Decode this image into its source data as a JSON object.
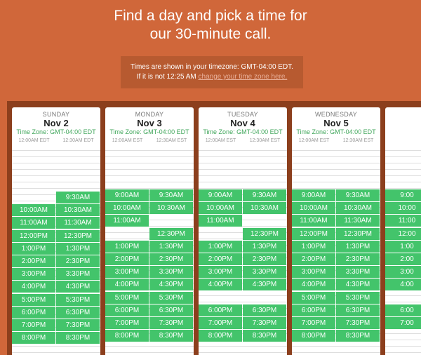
{
  "header": {
    "line1": "Find a day and pick a time for",
    "line2": "our 30-minute call."
  },
  "timezone_notice": {
    "text": "Times are shown in your timezone: GMT-04:00 EDT. If it is not 12:25 AM",
    "link": "change your time zone here."
  },
  "days": [
    {
      "weekday": "SUNDAY",
      "date": "Nov 2",
      "tz": "Time Zone: GMT-04:00 EDT",
      "col_left": "12:00AM EDT",
      "col_right": "12:30AM EDT",
      "slots": [
        {
          "time": "9:30AM",
          "col": "r",
          "row": 0
        },
        {
          "time": "10:00AM",
          "col": "l",
          "row": 1
        },
        {
          "time": "10:30AM",
          "col": "r",
          "row": 1
        },
        {
          "time": "11:00AM",
          "col": "l",
          "row": 2
        },
        {
          "time": "11:30AM",
          "col": "r",
          "row": 2
        },
        {
          "time": "12:00PM",
          "col": "l",
          "row": 3
        },
        {
          "time": "12:30PM",
          "col": "r",
          "row": 3
        },
        {
          "time": "1:00PM",
          "col": "l",
          "row": 4
        },
        {
          "time": "1:30PM",
          "col": "r",
          "row": 4
        },
        {
          "time": "2:00PM",
          "col": "l",
          "row": 5
        },
        {
          "time": "2:30PM",
          "col": "r",
          "row": 5
        },
        {
          "time": "3:00PM",
          "col": "l",
          "row": 6
        },
        {
          "time": "3:30PM",
          "col": "r",
          "row": 6
        },
        {
          "time": "4:00PM",
          "col": "l",
          "row": 7
        },
        {
          "time": "4:30PM",
          "col": "r",
          "row": 7
        },
        {
          "time": "5:00PM",
          "col": "l",
          "row": 8
        },
        {
          "time": "5:30PM",
          "col": "r",
          "row": 8
        },
        {
          "time": "6:00PM",
          "col": "l",
          "row": 9
        },
        {
          "time": "6:30PM",
          "col": "r",
          "row": 9
        },
        {
          "time": "7:00PM",
          "col": "l",
          "row": 10
        },
        {
          "time": "7:30PM",
          "col": "r",
          "row": 10
        },
        {
          "time": "8:00PM",
          "col": "l",
          "row": 11
        },
        {
          "time": "8:30PM",
          "col": "r",
          "row": 11
        }
      ]
    },
    {
      "weekday": "MONDAY",
      "date": "Nov 3",
      "tz": "Time Zone: GMT-04:00 EDT",
      "col_left": "12:00AM EST",
      "col_right": "12:30AM EST",
      "slots": [
        {
          "time": "9:00AM",
          "col": "l",
          "row": 0
        },
        {
          "time": "9:30AM",
          "col": "r",
          "row": 0
        },
        {
          "time": "10:00AM",
          "col": "l",
          "row": 1
        },
        {
          "time": "10:30AM",
          "col": "r",
          "row": 1
        },
        {
          "time": "11:00AM",
          "col": "l",
          "row": 2
        },
        {
          "time": "12:30PM",
          "col": "r",
          "row": 3
        },
        {
          "time": "1:00PM",
          "col": "l",
          "row": 4
        },
        {
          "time": "1:30PM",
          "col": "r",
          "row": 4
        },
        {
          "time": "2:00PM",
          "col": "l",
          "row": 5
        },
        {
          "time": "2:30PM",
          "col": "r",
          "row": 5
        },
        {
          "time": "3:00PM",
          "col": "l",
          "row": 6
        },
        {
          "time": "3:30PM",
          "col": "r",
          "row": 6
        },
        {
          "time": "4:00PM",
          "col": "l",
          "row": 7
        },
        {
          "time": "4:30PM",
          "col": "r",
          "row": 7
        },
        {
          "time": "5:00PM",
          "col": "l",
          "row": 8
        },
        {
          "time": "5:30PM",
          "col": "r",
          "row": 8
        },
        {
          "time": "6:00PM",
          "col": "l",
          "row": 9
        },
        {
          "time": "6:30PM",
          "col": "r",
          "row": 9
        },
        {
          "time": "7:00PM",
          "col": "l",
          "row": 10
        },
        {
          "time": "7:30PM",
          "col": "r",
          "row": 10
        },
        {
          "time": "8:00PM",
          "col": "l",
          "row": 11
        },
        {
          "time": "8:30PM",
          "col": "r",
          "row": 11
        }
      ]
    },
    {
      "weekday": "TUESDAY",
      "date": "Nov 4",
      "tz": "Time Zone: GMT-04:00 EDT",
      "col_left": "12:00AM EST",
      "col_right": "12:30AM EST",
      "slots": [
        {
          "time": "9:00AM",
          "col": "l",
          "row": 0
        },
        {
          "time": "9:30AM",
          "col": "r",
          "row": 0
        },
        {
          "time": "10:00AM",
          "col": "l",
          "row": 1
        },
        {
          "time": "10:30AM",
          "col": "r",
          "row": 1
        },
        {
          "time": "11:00AM",
          "col": "l",
          "row": 2
        },
        {
          "time": "12:30PM",
          "col": "r",
          "row": 3
        },
        {
          "time": "1:00PM",
          "col": "l",
          "row": 4
        },
        {
          "time": "1:30PM",
          "col": "r",
          "row": 4
        },
        {
          "time": "2:00PM",
          "col": "l",
          "row": 5
        },
        {
          "time": "2:30PM",
          "col": "r",
          "row": 5
        },
        {
          "time": "3:00PM",
          "col": "l",
          "row": 6
        },
        {
          "time": "3:30PM",
          "col": "r",
          "row": 6
        },
        {
          "time": "4:00PM",
          "col": "l",
          "row": 7
        },
        {
          "time": "4:30PM",
          "col": "r",
          "row": 7
        },
        {
          "time": "6:00PM",
          "col": "l",
          "row": 9
        },
        {
          "time": "6:30PM",
          "col": "r",
          "row": 9
        },
        {
          "time": "7:00PM",
          "col": "l",
          "row": 10
        },
        {
          "time": "7:30PM",
          "col": "r",
          "row": 10
        },
        {
          "time": "8:00PM",
          "col": "l",
          "row": 11
        },
        {
          "time": "8:30PM",
          "col": "r",
          "row": 11
        }
      ]
    },
    {
      "weekday": "WEDNESDAY",
      "date": "Nov 5",
      "tz": "Time Zone: GMT-04:00 EDT",
      "col_left": "12:00AM EST",
      "col_right": "12:30AM EST",
      "slots": [
        {
          "time": "9:00AM",
          "col": "l",
          "row": 0
        },
        {
          "time": "9:30AM",
          "col": "r",
          "row": 0
        },
        {
          "time": "10:00AM",
          "col": "l",
          "row": 1
        },
        {
          "time": "10:30AM",
          "col": "r",
          "row": 1
        },
        {
          "time": "11:00AM",
          "col": "l",
          "row": 2
        },
        {
          "time": "11:30AM",
          "col": "r",
          "row": 2
        },
        {
          "time": "12:00PM",
          "col": "l",
          "row": 3
        },
        {
          "time": "12:30PM",
          "col": "r",
          "row": 3
        },
        {
          "time": "1:00PM",
          "col": "l",
          "row": 4
        },
        {
          "time": "1:30PM",
          "col": "r",
          "row": 4
        },
        {
          "time": "2:00PM",
          "col": "l",
          "row": 5
        },
        {
          "time": "2:30PM",
          "col": "r",
          "row": 5
        },
        {
          "time": "3:00PM",
          "col": "l",
          "row": 6
        },
        {
          "time": "3:30PM",
          "col": "r",
          "row": 6
        },
        {
          "time": "4:00PM",
          "col": "l",
          "row": 7
        },
        {
          "time": "4:30PM",
          "col": "r",
          "row": 7
        },
        {
          "time": "5:00PM",
          "col": "l",
          "row": 8
        },
        {
          "time": "5:30PM",
          "col": "r",
          "row": 8
        },
        {
          "time": "6:00PM",
          "col": "l",
          "row": 9
        },
        {
          "time": "6:30PM",
          "col": "r",
          "row": 9
        },
        {
          "time": "7:00PM",
          "col": "l",
          "row": 10
        },
        {
          "time": "7:30PM",
          "col": "r",
          "row": 10
        },
        {
          "time": "8:00PM",
          "col": "l",
          "row": 11
        },
        {
          "time": "8:30PM",
          "col": "r",
          "row": 11
        }
      ]
    },
    {
      "weekday": "T",
      "date": "",
      "tz": "Tim",
      "col_left": "",
      "col_right": "",
      "slots": [
        {
          "time": "9:00",
          "col": "l",
          "row": 0
        },
        {
          "time": "10:00",
          "col": "l",
          "row": 1
        },
        {
          "time": "11:00",
          "col": "l",
          "row": 2
        },
        {
          "time": "12:00",
          "col": "l",
          "row": 3
        },
        {
          "time": "1:00",
          "col": "l",
          "row": 4
        },
        {
          "time": "2:00",
          "col": "l",
          "row": 5
        },
        {
          "time": "3:00",
          "col": "l",
          "row": 6
        },
        {
          "time": "4:00",
          "col": "l",
          "row": 7
        },
        {
          "time": "6:00",
          "col": "l",
          "row": 9
        },
        {
          "time": "7:00",
          "col": "l",
          "row": 10
        }
      ]
    }
  ]
}
